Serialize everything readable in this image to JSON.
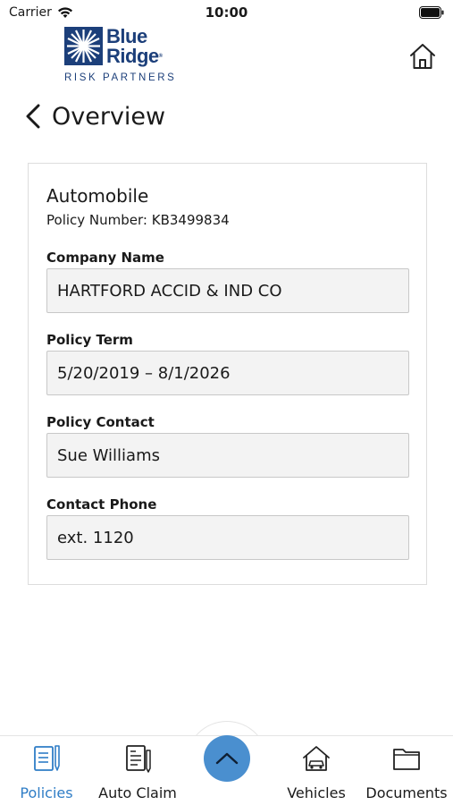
{
  "status_bar": {
    "carrier": "Carrier",
    "time": "10:00"
  },
  "brand": {
    "name_line1": "Blue",
    "name_line2": "Ridge",
    "tagline": "RISK PARTNERS",
    "color": "#1c3f7a"
  },
  "header": {
    "title": "Overview"
  },
  "policy": {
    "type": "Automobile",
    "number_line": "Policy Number: KB3499834",
    "fields": [
      {
        "label": "Company Name",
        "value": "HARTFORD ACCID & IND CO"
      },
      {
        "label": "Policy Term",
        "value": "5/20/2019 – 8/1/2026"
      },
      {
        "label": "Policy Contact",
        "value": "Sue Williams"
      },
      {
        "label": "Contact Phone",
        "value": "ext. 1120"
      }
    ]
  },
  "tabs": [
    {
      "label": "Policies",
      "icon": "policies-icon",
      "active": true
    },
    {
      "label": "Auto Claim",
      "icon": "auto-claim-icon",
      "active": false
    },
    {
      "label": "Vehicles",
      "icon": "vehicles-icon",
      "active": false
    },
    {
      "label": "Documents",
      "icon": "folder-icon",
      "active": false
    }
  ],
  "colors": {
    "accent": "#2f7dc6",
    "center_button": "#4a8fcf",
    "field_background": "#f3f3f3"
  }
}
